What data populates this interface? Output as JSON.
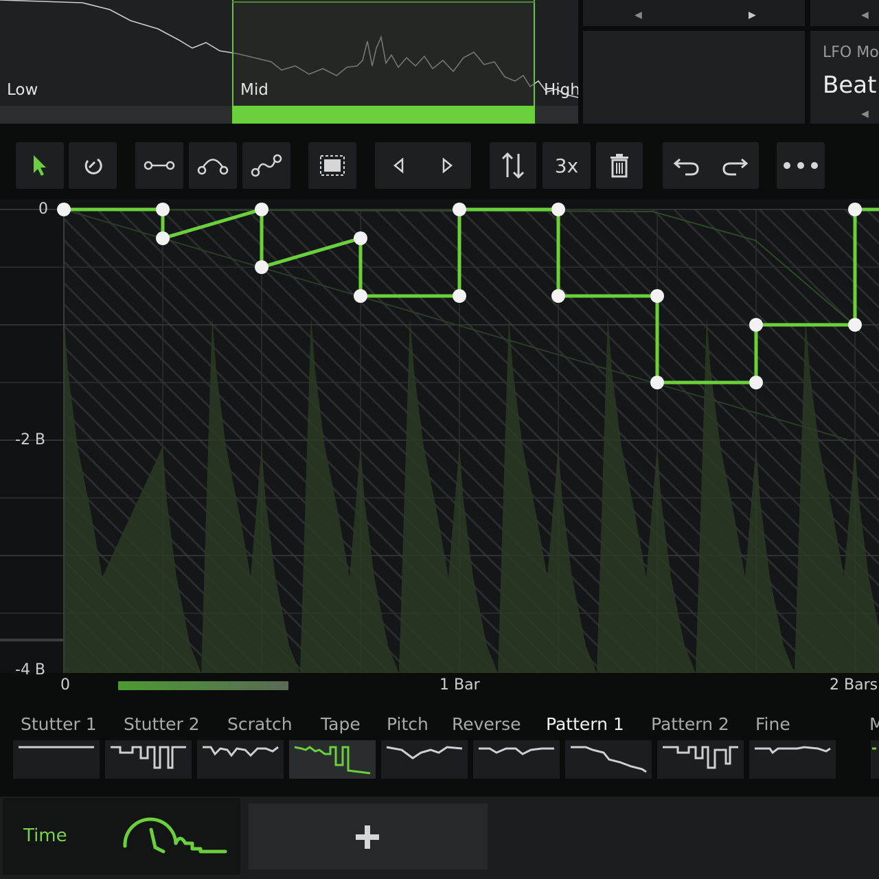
{
  "band": {
    "low_label": "Low",
    "mid_label": "Mid",
    "high_label": "High",
    "accent": "#6ad13c"
  },
  "lfo": {
    "title": "LFO Mo",
    "value": "Beat"
  },
  "toolbar": {
    "items": [
      {
        "icon": "pointer-icon",
        "active": true
      },
      {
        "icon": "magnet-icon"
      },
      {
        "icon": "linear-curve-icon"
      },
      {
        "icon": "arc-curve-icon"
      },
      {
        "icon": "s-curve-icon"
      },
      {
        "icon": "select-all-icon"
      },
      {
        "icon": "shift-left-icon"
      },
      {
        "icon": "shift-right-icon"
      },
      {
        "icon": "flip-vertical-icon"
      },
      {
        "icon": "multiply-label",
        "label": "3x"
      },
      {
        "icon": "trash-icon"
      },
      {
        "icon": "undo-icon"
      },
      {
        "icon": "redo-icon"
      },
      {
        "icon": "more-icon"
      }
    ]
  },
  "graph": {
    "y_labels": [
      "0",
      "-2 B",
      "-4 B"
    ],
    "x_labels": [
      "0",
      "1 Bar",
      "2 Bars"
    ],
    "curve_color": "#6ad13c"
  },
  "presets": [
    {
      "name": "Stutter 1"
    },
    {
      "name": "Stutter 2"
    },
    {
      "name": "Scratch"
    },
    {
      "name": "Tape",
      "active": true
    },
    {
      "name": "Pitch"
    },
    {
      "name": "Reverse"
    },
    {
      "name": "Pattern 1",
      "selected": true
    },
    {
      "name": "Pattern 2"
    },
    {
      "name": "Fine"
    },
    {
      "name": "M"
    }
  ],
  "bottom": {
    "time_label": "Time",
    "add_icon": "plus-icon"
  }
}
